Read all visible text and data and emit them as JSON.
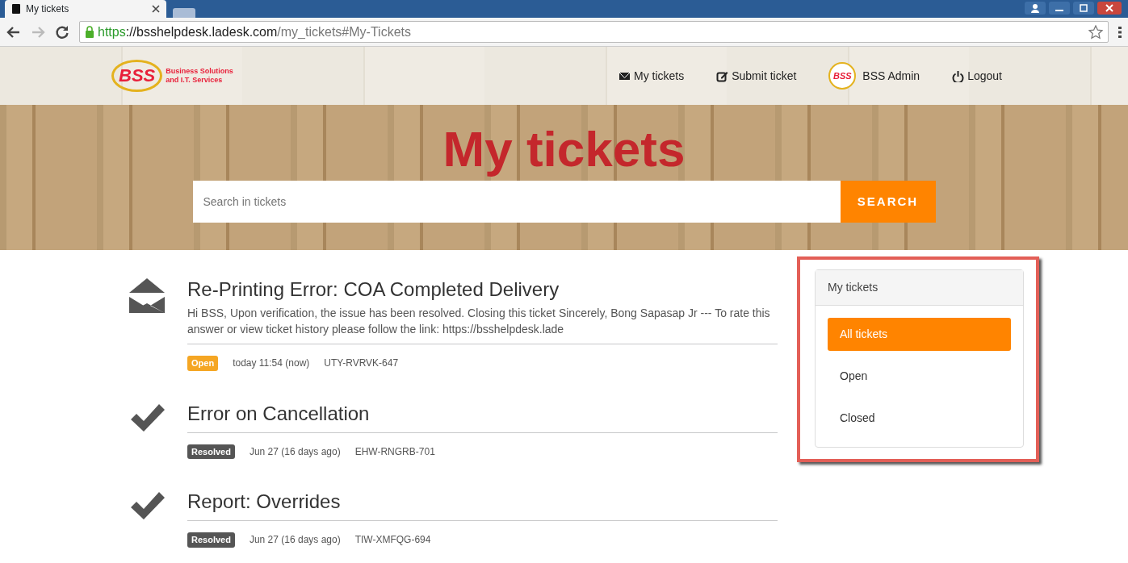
{
  "browser": {
    "tab_title": "My tickets",
    "url_scheme": "https",
    "url_host": "://bsshelpdesk.ladesk.com",
    "url_path": "/my_tickets#My-Tickets"
  },
  "header": {
    "logo": {
      "mark": "BSS",
      "line_1": "Business Solutions",
      "line_2": "and I.T. Services"
    },
    "nav": [
      {
        "kind": "envelope",
        "label": "My tickets"
      },
      {
        "kind": "edit",
        "label": "Submit ticket"
      },
      {
        "kind": "avatar",
        "avatar_text": "BSS",
        "label": "BSS Admin"
      },
      {
        "kind": "power",
        "label": "Logout"
      }
    ]
  },
  "hero": {
    "title": "My tickets",
    "search": {
      "placeholder": "Search in tickets",
      "button": "SEARCH"
    }
  },
  "tickets": [
    {
      "kind": "envelope",
      "title": "Re-Printing Error: COA Completed Delivery",
      "excerpt": "Hi BSS, Upon verification, the issue has been resolved. Closing this ticket Sincerely, Bong Sapasap Jr --- To rate this answer or view ticket history please follow the link: https://bsshelpdesk.lade",
      "status": {
        "label": "Open",
        "kind": "open"
      },
      "date": "today 11:54 (now)",
      "code": "UTY-RVRVK-647"
    },
    {
      "kind": "check",
      "title": "Error on Cancellation",
      "status": {
        "label": "Resolved",
        "kind": "resolved"
      },
      "date": "Jun 27 (16 days ago)",
      "code": "EHW-RNGRB-701"
    },
    {
      "kind": "check",
      "title": "Report: Overrides",
      "status": {
        "label": "Resolved",
        "kind": "resolved"
      },
      "date": "Jun 27 (16 days ago)",
      "code": "TIW-XMFQG-694"
    }
  ],
  "filter_panel": {
    "title": "My tickets",
    "items": [
      {
        "label": "All tickets",
        "selected": true
      },
      {
        "label": "Open",
        "selected": false
      },
      {
        "label": "Closed",
        "selected": false
      }
    ]
  }
}
